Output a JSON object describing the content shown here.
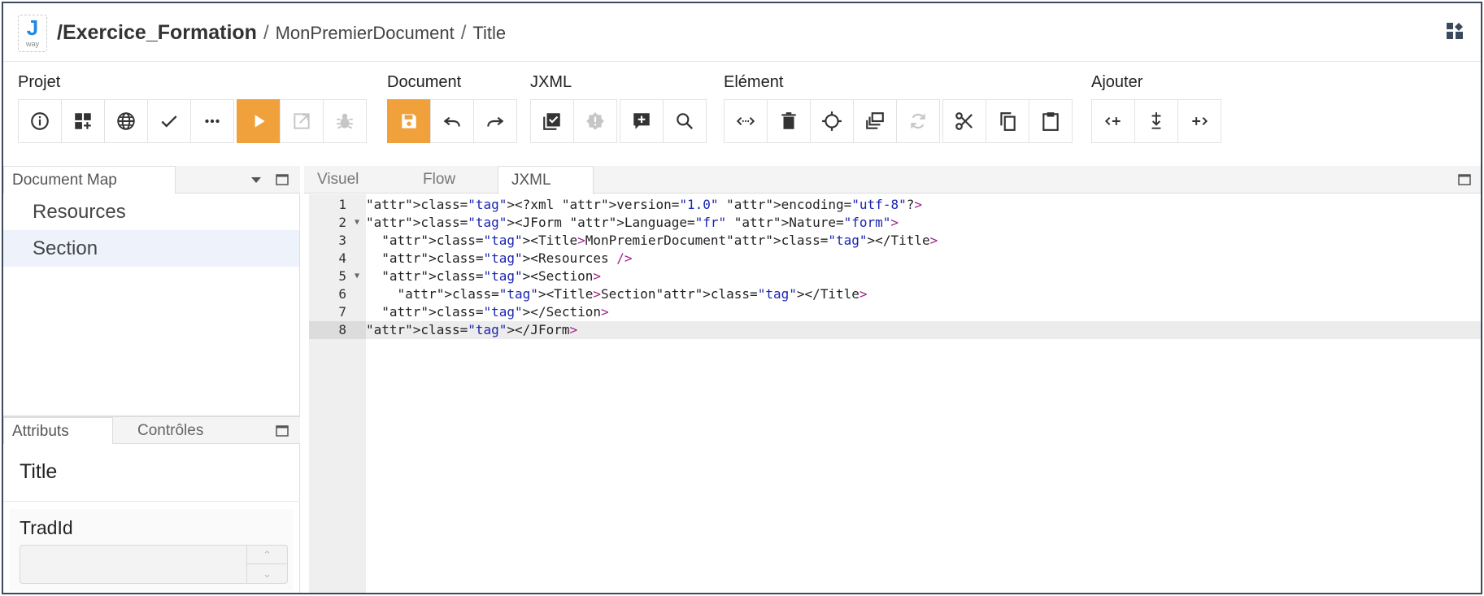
{
  "titlebar": {
    "logo_letter": "J",
    "logo_sub": "way",
    "project": "/Exercice_Formation",
    "separator": "/",
    "breadcrumbs": [
      "MonPremierDocument",
      "Title"
    ]
  },
  "toolbar": {
    "groups": [
      {
        "label": "Projet",
        "buttons": [
          "info-icon",
          "dashboard-add-icon",
          "globe-icon",
          "check-icon",
          "more-icon",
          "play-icon",
          "open-external-icon",
          "bug-icon"
        ]
      },
      {
        "label": "Document",
        "buttons": [
          "save-icon",
          "undo-icon",
          "redo-icon"
        ]
      },
      {
        "label": "JXML",
        "buttons": [
          "validate-icon",
          "error-badge-icon",
          "add-comment-icon",
          "search-icon"
        ]
      },
      {
        "label": "Elément",
        "buttons": [
          "expand-horizontal-icon",
          "delete-icon",
          "crosshair-icon",
          "duplicate-icon",
          "refresh-icon",
          "cut-icon",
          "copy-icon",
          "paste-icon"
        ]
      },
      {
        "label": "Ajouter",
        "buttons": [
          "insert-before-icon",
          "insert-child-icon",
          "insert-after-icon"
        ]
      }
    ],
    "accent_color": "#f0a13c"
  },
  "document_map": {
    "tab_label": "Document Map",
    "items": [
      "Resources",
      "Section"
    ],
    "selected": "Section"
  },
  "attributes_panel": {
    "tabs": [
      "Attributs",
      "Contrôles"
    ],
    "element_title": "Title",
    "field_label": "TradId",
    "field_value": ""
  },
  "editor": {
    "tabs": [
      "Visuel",
      "Flow",
      "JXML"
    ],
    "active_tab": "JXML",
    "line_numbers": [
      "1",
      "2",
      "3",
      "4",
      "5",
      "6",
      "7",
      "8"
    ],
    "active_line": "8",
    "code_lines": [
      "<?xml version=\"1.0\" encoding=\"utf-8\"?>",
      "<JForm Language=\"fr\" Nature=\"form\">",
      "  <Title>MonPremierDocument</Title>",
      "  <Resources />",
      "  <Section>",
      "    <Title>Section</Title>",
      "  </Section>",
      "</JForm>"
    ]
  }
}
